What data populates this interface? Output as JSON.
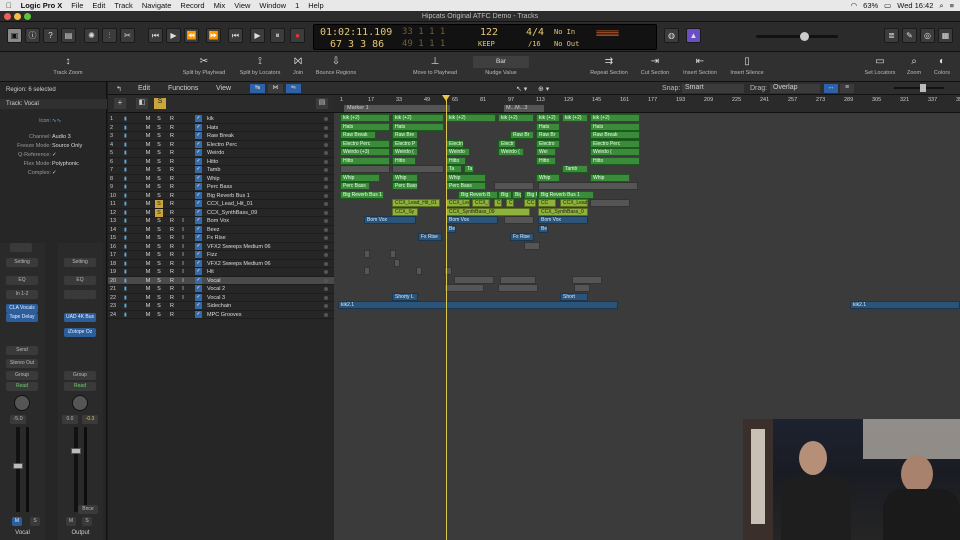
{
  "menubar": {
    "app": "Logic Pro X",
    "items": [
      "File",
      "Edit",
      "Track",
      "Navigate",
      "Record",
      "Mix",
      "View",
      "Window",
      "1",
      "Help"
    ],
    "battery": "63%",
    "clock": "Wed 16:42"
  },
  "window": {
    "title": "Hipcats Original ATFC Demo - Tracks"
  },
  "lcd": {
    "time": "01:02:11.109",
    "bars": "67  3  3  86",
    "ghost_top": "33  1  1  1",
    "ghost_bottom": "49  1  1  1",
    "tempo": "122",
    "tempo_mode": "KEEP",
    "sig": "4/4",
    "div": "/16",
    "in": "No In",
    "out": "No Out"
  },
  "toolbar": {
    "items": [
      "Track Zoom",
      "Split by Playhead",
      "Split by Locators",
      "Join",
      "Bounce Regions",
      "Move to Playhead",
      "Nudge Value",
      "Repeat Section",
      "Cut Section",
      "Insert Section",
      "Insert Silence",
      "Set Locators",
      "Zoom",
      "Colors"
    ],
    "nudge": "Bar"
  },
  "inspector": {
    "region_label": "Region: 6 selected",
    "track_label": "Track: Vocal",
    "icon_label": "Icon:",
    "rows": [
      {
        "k": "Channel:",
        "v": "Audio 3"
      },
      {
        "k": "Freeze Mode:",
        "v": "Source Only"
      },
      {
        "k": "Q-Reference:",
        "v": "✓"
      },
      {
        "k": "Flex Mode:",
        "v": "Polyphonic"
      },
      {
        "k": "Complex:",
        "v": "✓"
      }
    ]
  },
  "strips": [
    {
      "name": "Vocal",
      "setting": "Setting",
      "eq": "EQ",
      "input": "In 1-2",
      "plugins": [
        "CLA Vocals",
        "Tape Delay"
      ],
      "send": "Send",
      "out": "Stereo Out",
      "group": "Group",
      "auto": "Read",
      "vol": "-5.0",
      "mute": "M",
      "solo": "S"
    },
    {
      "name": "Output",
      "setting": "Setting",
      "eq": "EQ",
      "input": "",
      "plugins": [
        "UAD 4K Bus",
        "iZotope Oz"
      ],
      "send": "",
      "out": "",
      "group": "Group",
      "auto": "Read",
      "vol": "0.0",
      "vol2": "-0.3",
      "mute": "M",
      "solo": "S",
      "bnce": "Bnce"
    }
  ],
  "trackhdr": {
    "edit": "Edit",
    "functions": "Functions",
    "view": "View"
  },
  "arrhdr": {
    "snap_label": "Snap:",
    "snap": "Smart",
    "drag_label": "Drag:",
    "drag": "Overlap"
  },
  "tracks": [
    {
      "n": "1",
      "name": "kik"
    },
    {
      "n": "2",
      "name": "Hats"
    },
    {
      "n": "3",
      "name": "Raw Break"
    },
    {
      "n": "4",
      "name": "Electro Perc"
    },
    {
      "n": "5",
      "name": "Weirdo"
    },
    {
      "n": "6",
      "name": "Hitto"
    },
    {
      "n": "7",
      "name": "Tamb"
    },
    {
      "n": "8",
      "name": "Whip"
    },
    {
      "n": "9",
      "name": "Perc Bass"
    },
    {
      "n": "10",
      "name": "Big Reverb Bus 1"
    },
    {
      "n": "11",
      "name": "CCX_Lead_Hit_01"
    },
    {
      "n": "12",
      "name": "CCX_SynthBass_09"
    },
    {
      "n": "13",
      "name": "Bom Vox"
    },
    {
      "n": "14",
      "name": "Beez"
    },
    {
      "n": "15",
      "name": "Fx Rise"
    },
    {
      "n": "16",
      "name": "VFX2 Sweeps Medium 06"
    },
    {
      "n": "17",
      "name": "Fizz"
    },
    {
      "n": "18",
      "name": "VFX2 Sweeps Medium 06"
    },
    {
      "n": "19",
      "name": "Hit"
    },
    {
      "n": "20",
      "name": "Vocal"
    },
    {
      "n": "21",
      "name": "Vocal 2"
    },
    {
      "n": "22",
      "name": "Vocal 3"
    },
    {
      "n": "23",
      "name": "Sidechain"
    },
    {
      "n": "24",
      "name": "MPC Grooves"
    }
  ],
  "ruler": {
    "marker": "Marker 1",
    "marker2": "M...M...3",
    "ticks": [
      "1",
      "17",
      "33",
      "49",
      "65",
      "81",
      "97",
      "113",
      "129",
      "145",
      "161",
      "177",
      "193",
      "209",
      "225",
      "241",
      "257",
      "273",
      "289",
      "305",
      "321",
      "337",
      "353"
    ]
  },
  "regions": {
    "kik": "kik (+2)",
    "hats": "Hats",
    "raw": "Raw Break",
    "raw_s": "Raw Bre",
    "raw_b": "Raw Br",
    "ep": "Electro Perc",
    "ep_s": "Electro P",
    "ep_t": "Electro",
    "ep_u": "Electr",
    "w": "Weirdo (+3)",
    "w_s": "Weirdo (",
    "w_t": "Weirdo",
    "w_u": "Wei",
    "hit": "Hitto",
    "tamb": "Tamb",
    "ta": "Ta",
    "t": "T",
    "whip": "Whip",
    "pb": "Perc Bass",
    "brb": "Big Reverb Bus 1",
    "brb_s": "Big Reverb B",
    "big": "Big",
    "big_r": "Big R",
    "ccx_l": "CCX_Lead_Hit_01",
    "ccx_l2": "CCX_Lea",
    "ccx_le": "CCX_Le",
    "ccx_lead": "CCX_Lead",
    "ccx_sb": "CCX_SynthBass_09",
    "ccx_sb0": "CCX_SynthBass_0",
    "cc": "CC",
    "c": "C",
    "cx_sy": "CCX_Sy",
    "bom": "Bom Vox",
    "bee": "Bee",
    "fx": "Fx Rise",
    "shorty": "Shorty L",
    "short": "Short",
    "kik21": "kik2.1"
  },
  "video": {
    "caption": ""
  }
}
